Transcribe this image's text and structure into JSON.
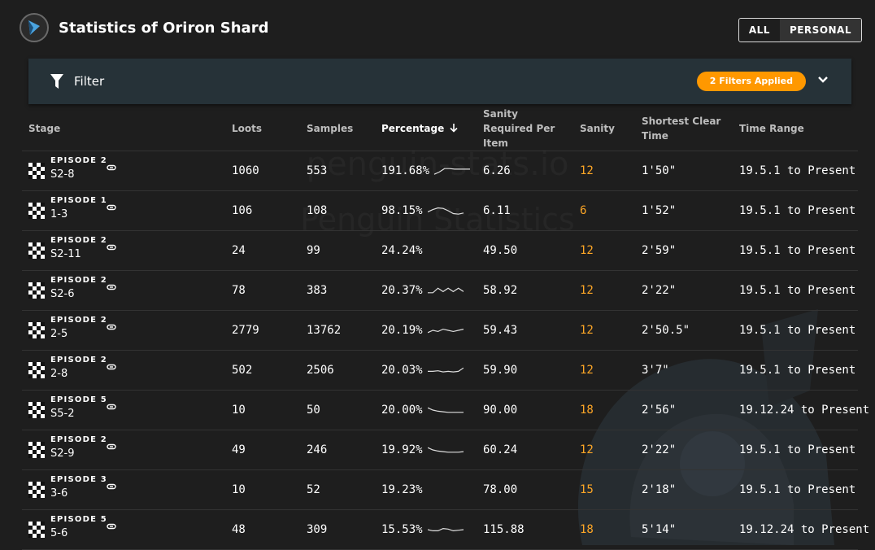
{
  "header": {
    "title": "Statistics of Oriron Shard",
    "toggle": [
      "ALL",
      "PERSONAL"
    ],
    "active_toggle": "PERSONAL"
  },
  "filter": {
    "label": "Filter",
    "badge": "2 Filters Applied"
  },
  "watermark": [
    "penguin-stats.io",
    "Penguin Statistics"
  ],
  "table": {
    "columns": [
      "Stage",
      "Loots",
      "Samples",
      "Percentage",
      "Sanity Required Per Item",
      "Sanity",
      "Shortest Clear Time",
      "Time Range"
    ],
    "rows": [
      {
        "episode": "EPISODE 2",
        "code": "S2-8",
        "loots": "1060",
        "samples": "553",
        "percentage": "191.68%",
        "per_item": "6.26",
        "sanity": "12",
        "clear": "1'50\"",
        "range": "19.5.1 to Present",
        "spark": [
          0.8,
          0.6,
          0.3,
          0.3,
          0.35,
          0.35,
          0.35,
          0.35
        ]
      },
      {
        "episode": "EPISODE 1",
        "code": "1-3",
        "loots": "106",
        "samples": "108",
        "percentage": "98.15%",
        "per_item": "6.11",
        "sanity": "6",
        "clear": "1'52\"",
        "range": "19.5.1 to Present",
        "spark": [
          0.6,
          0.4,
          0.25,
          0.3,
          0.5,
          0.75,
          0.8,
          0.7
        ]
      },
      {
        "episode": "EPISODE 2",
        "code": "S2-11",
        "loots": "24",
        "samples": "99",
        "percentage": "24.24%",
        "per_item": "49.50",
        "sanity": "12",
        "clear": "2'59\"",
        "range": "19.5.1 to Present",
        "spark": []
      },
      {
        "episode": "EPISODE 2",
        "code": "S2-6",
        "loots": "78",
        "samples": "383",
        "percentage": "20.37%",
        "per_item": "58.92",
        "sanity": "12",
        "clear": "2'22\"",
        "range": "19.5.1 to Present",
        "spark": [
          0.7,
          0.7,
          0.3,
          0.6,
          0.3,
          0.6,
          0.3,
          0.6
        ]
      },
      {
        "episode": "EPISODE 2",
        "code": "2-5",
        "loots": "2779",
        "samples": "13762",
        "percentage": "20.19%",
        "per_item": "59.43",
        "sanity": "12",
        "clear": "2'50.5\"",
        "range": "19.5.1 to Present",
        "spark": [
          0.7,
          0.5,
          0.6,
          0.4,
          0.5,
          0.6,
          0.5,
          0.4
        ]
      },
      {
        "episode": "EPISODE 2",
        "code": "2-8",
        "loots": "502",
        "samples": "2506",
        "percentage": "20.03%",
        "per_item": "59.90",
        "sanity": "12",
        "clear": "3'7\"",
        "range": "19.5.1 to Present",
        "spark": [
          0.6,
          0.6,
          0.55,
          0.65,
          0.6,
          0.65,
          0.6,
          0.3
        ]
      },
      {
        "episode": "EPISODE 5",
        "code": "S5-2",
        "loots": "10",
        "samples": "50",
        "percentage": "20.00%",
        "per_item": "90.00",
        "sanity": "18",
        "clear": "2'56\"",
        "range": "19.12.24 to Present",
        "spark": [
          0.3,
          0.5,
          0.6,
          0.65,
          0.7,
          0.7,
          0.7,
          0.7
        ]
      },
      {
        "episode": "EPISODE 2",
        "code": "S2-9",
        "loots": "49",
        "samples": "246",
        "percentage": "19.92%",
        "per_item": "60.24",
        "sanity": "12",
        "clear": "2'22\"",
        "range": "19.5.1 to Present",
        "spark": [
          0.3,
          0.5,
          0.6,
          0.65,
          0.7,
          0.7,
          0.7,
          0.65
        ]
      },
      {
        "episode": "EPISODE 3",
        "code": "3-6",
        "loots": "10",
        "samples": "52",
        "percentage": "19.23%",
        "per_item": "78.00",
        "sanity": "15",
        "clear": "2'18\"",
        "range": "19.5.1 to Present",
        "spark": []
      },
      {
        "episode": "EPISODE 5",
        "code": "5-6",
        "loots": "48",
        "samples": "309",
        "percentage": "15.53%",
        "per_item": "115.88",
        "sanity": "18",
        "clear": "5'14\"",
        "range": "19.12.24 to Present",
        "spark": [
          0.5,
          0.6,
          0.6,
          0.4,
          0.45,
          0.6,
          0.55,
          0.5
        ]
      }
    ]
  },
  "colors": {
    "accent": "#ff9800",
    "sanity": "#ffa726",
    "filter_bar": "#263238"
  }
}
